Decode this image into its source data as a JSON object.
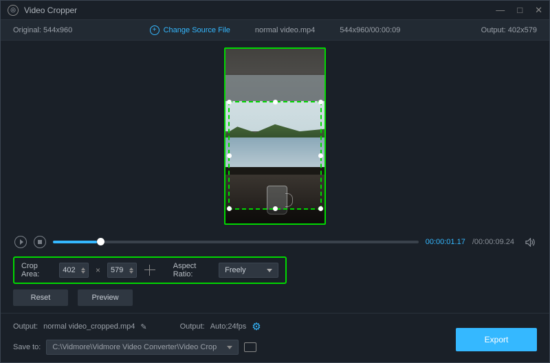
{
  "window": {
    "title": "Video Cropper"
  },
  "info": {
    "original": "Original:  544x960",
    "changeSource": "Change Source File",
    "filename": "normal video.mp4",
    "dimDuration": "544x960/00:00:09",
    "output": "Output: 402x579"
  },
  "playbar": {
    "current": "00:00:01.17",
    "total": "/00:00:09.24"
  },
  "crop": {
    "areaLabel": "Crop Area:",
    "width": "402",
    "height": "579",
    "aspectLabel": "Aspect Ratio:",
    "aspectValue": "Freely"
  },
  "buttons": {
    "reset": "Reset",
    "preview": "Preview",
    "export": "Export"
  },
  "output": {
    "label1": "Output:",
    "filename": "normal video_cropped.mp4",
    "label2": "Output:",
    "format": "Auto;24fps"
  },
  "save": {
    "label": "Save to:",
    "path": "C:\\Vidmore\\Vidmore Video Converter\\Video Crop"
  }
}
